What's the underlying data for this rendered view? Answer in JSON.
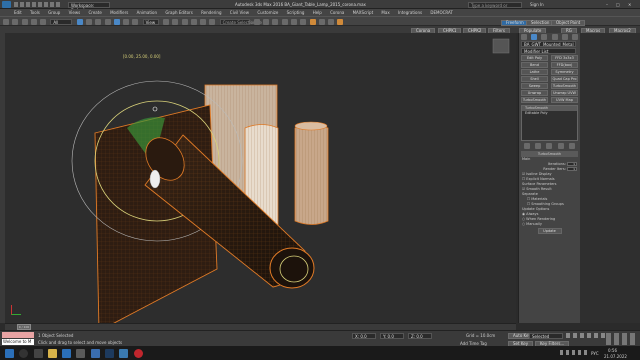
{
  "window": {
    "title": "Autodesk 3ds Max 2016    BA_Giant_Table_Lamp_2015_corona.max",
    "workspace": "Workspace: Default",
    "search_placeholder": "Type a keyword or phrase",
    "sign_in": "Sign In"
  },
  "menus": [
    "Edit",
    "Tools",
    "Group",
    "Views",
    "Create",
    "Modifiers",
    "Animation",
    "Graph Editors",
    "Rendering",
    "Civil View",
    "Customize",
    "Scripting",
    "Help",
    "Corona",
    "MAXScript",
    "Max",
    "Integrations",
    "DEMOCRAT"
  ],
  "toolbar": {
    "selection_filter": "All",
    "view_dropdown": "View",
    "named_selection": "Create Selection Se"
  },
  "tabs_right": [
    "Corona",
    "CHPK1",
    "CHPK2",
    "Filters",
    "Freeform",
    "Selection",
    "Object Paint",
    "Populate",
    "RG",
    "Macros",
    "Macros2"
  ],
  "viewport": {
    "label": "[+] [Perspective ] [Shaded + Edged Faces ]",
    "gizmo_readout": "[0.00, 25.00, 0.00]"
  },
  "command_panel": {
    "object_name": "BA_GWT_Mounted_Metal_0206",
    "modifier_list": "Modifier List",
    "buttons": [
      [
        "Edit Poly",
        "FFD 3x3x3"
      ],
      [
        "Bend",
        "FFD(box)"
      ],
      [
        "Lathe",
        "Symmetry"
      ],
      [
        "Shell",
        "Quad Cap Pro"
      ],
      [
        "Sweep",
        "TurboSmooth"
      ],
      [
        "Unwrap",
        "Unwrap UVW"
      ],
      [
        "TurboSmooth",
        "UVW Map"
      ]
    ],
    "stack": [
      "TurboSmooth",
      "Editable Poly"
    ],
    "rollout_title": "TurboSmooth",
    "main_label": "Main",
    "iterations_label": "Iterations:",
    "iterations_value": "1",
    "render_iters_label": "Render Iters:",
    "render_iters_value": "1",
    "isoline_display": "Isoline Display",
    "explicit_normals": "Explicit Normals",
    "surface_params": "Surface Parameters",
    "smooth_result": "Smooth Result",
    "separate": "Separate",
    "materials": "Materials",
    "smoothing_groups": "Smoothing Groups",
    "update_options": "Update Options",
    "always": "Always",
    "when_rendering": "When Rendering",
    "manually": "Manually",
    "update_button": "Update"
  },
  "timeline": {
    "position": "0 / 100"
  },
  "status": {
    "object_selected": "1 Object Selected",
    "hint": "Click and drag to select and move objects",
    "maxscript": "Welcome to M",
    "x": "X: 0.0",
    "y": "Y: 0.0",
    "z": "Z: 0.0",
    "grid": "Grid = 10.0cm",
    "auto_key": "Auto Key",
    "selected": "Selected",
    "set_key": "Set Key",
    "key_filters": "Key Filters...",
    "add_time_tag": "Add Time Tag"
  },
  "taskbar": {
    "time": "0:56",
    "date": "21.07.2022",
    "lang": "РУС"
  },
  "colors": {
    "selection_orange": "#e07a26",
    "accent_blue": "#4a88c7",
    "gizmo_yellow": "#d9d27a"
  }
}
